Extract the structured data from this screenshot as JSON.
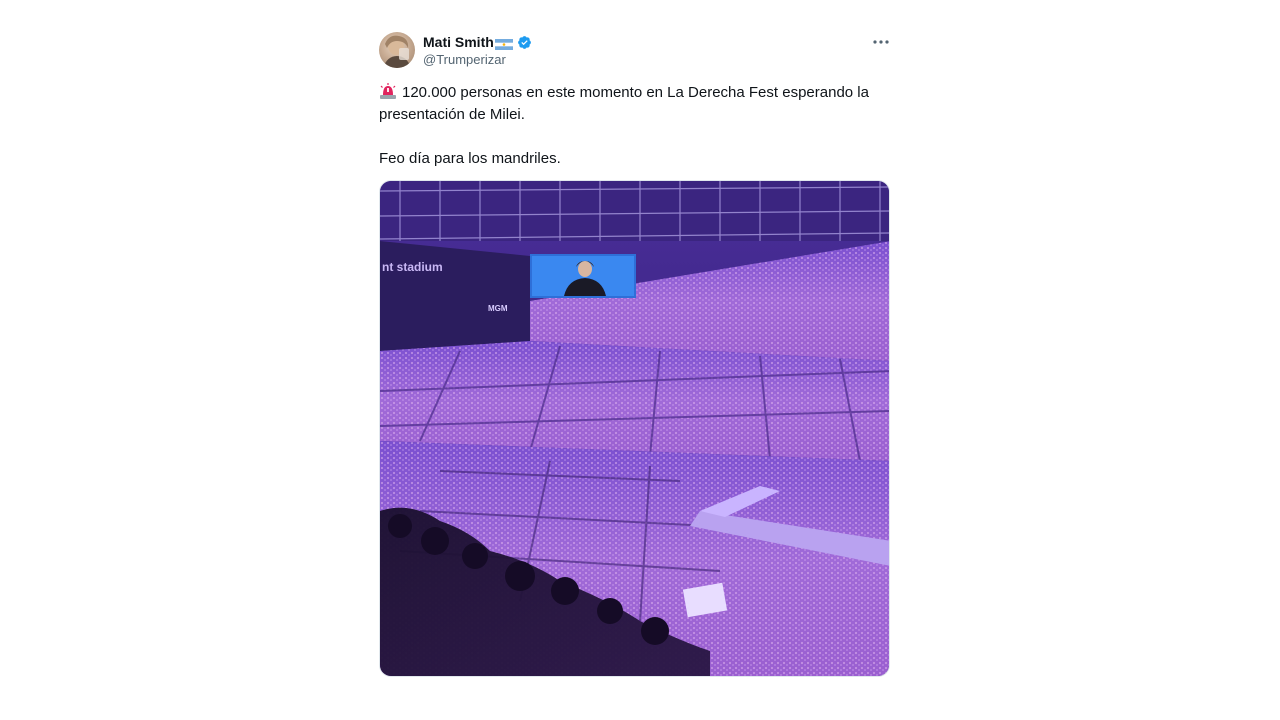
{
  "tweet": {
    "author": {
      "display_name": "Mati Smith",
      "handle": "@Trumperizar",
      "flag_icon": "argentina-flag-icon",
      "verified_icon": "verified-badge-icon",
      "verified_color": "#1d9bf0"
    },
    "more_icon": "more-options-icon",
    "text": {
      "emoji_icon": "police-light-icon",
      "line1": "120.000 personas en este momento en La Derecha Fest esperando la presentación de Milei.",
      "line2": "Feo día para los mandriles."
    },
    "media": {
      "screen_sign": "nt stadium",
      "sign_small": "MGM"
    }
  }
}
